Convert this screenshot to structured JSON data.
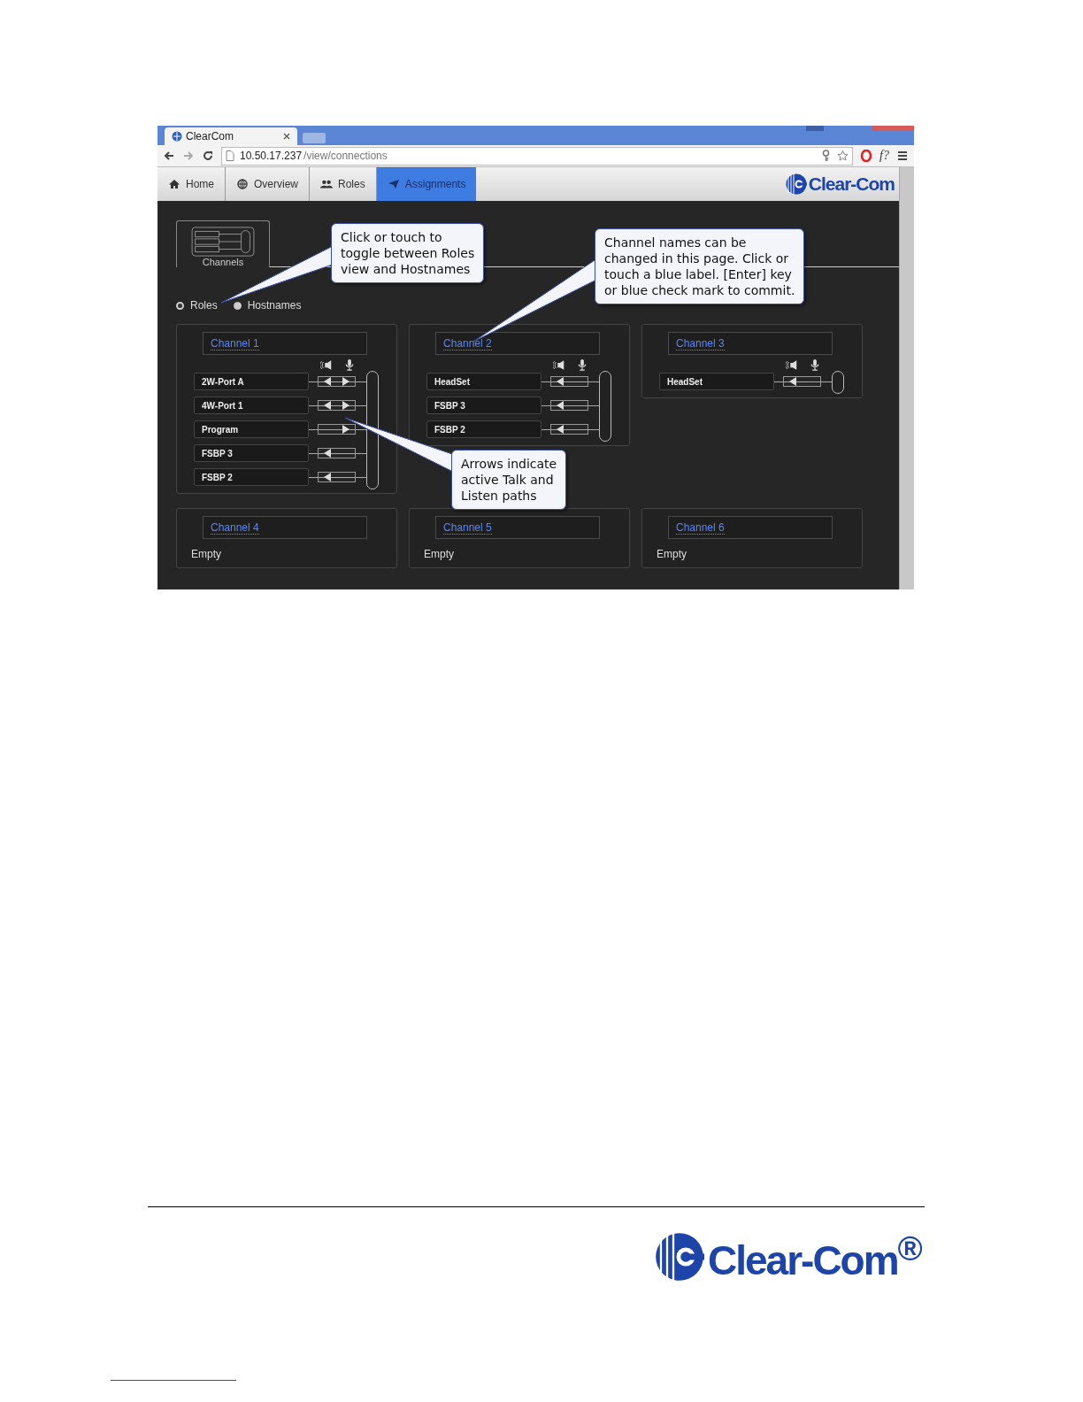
{
  "browser": {
    "tab_title": "ClearCom",
    "url_host": "10.50.17.237",
    "url_path": "/view/connections",
    "extension_label": "f?"
  },
  "nav": {
    "tabs": [
      {
        "label": "Home",
        "selected": false
      },
      {
        "label": "Overview",
        "selected": false
      },
      {
        "label": "Roles",
        "selected": false
      },
      {
        "label": "Assignments",
        "selected": true
      }
    ],
    "logo": "Clear-Com"
  },
  "view_tab": {
    "label": "Channels"
  },
  "view_options": [
    {
      "label": "Roles",
      "selected": true
    },
    {
      "label": "Hostnames",
      "selected": false
    }
  ],
  "channels": [
    {
      "name": "Channel 1",
      "ports": [
        {
          "name": "2W-Port A",
          "listen": true,
          "talk": true
        },
        {
          "name": "4W-Port 1",
          "listen": true,
          "talk": true
        },
        {
          "name": "Program",
          "listen": false,
          "talk": true
        },
        {
          "name": "FSBP 3",
          "listen": true,
          "talk": false
        },
        {
          "name": "FSBP 2",
          "listen": true,
          "talk": false
        }
      ]
    },
    {
      "name": "Channel 2",
      "ports": [
        {
          "name": "HeadSet",
          "listen": true,
          "talk": false
        },
        {
          "name": "FSBP 3",
          "listen": true,
          "talk": false
        },
        {
          "name": "FSBP 2",
          "listen": true,
          "talk": false
        }
      ]
    },
    {
      "name": "Channel 3",
      "ports": [
        {
          "name": "HeadSet",
          "listen": true,
          "talk": false
        }
      ]
    },
    {
      "name": "Channel 4",
      "empty_text": "Empty"
    },
    {
      "name": "Channel 5",
      "empty_text": "Empty"
    },
    {
      "name": "Channel 6",
      "empty_text": "Empty"
    }
  ],
  "callouts": [
    {
      "text": "Click or touch to\ntoggle between Roles\nview and Hostnames"
    },
    {
      "text": "Channel names can be\nchanged in this page. Click or\ntouch a blue label. [Enter] key\nor blue check mark to commit."
    },
    {
      "text": "Arrows indicate\nactive Talk and\nListen paths"
    }
  ],
  "footer": {
    "logo": "Clear-Com$^{®}$"
  }
}
